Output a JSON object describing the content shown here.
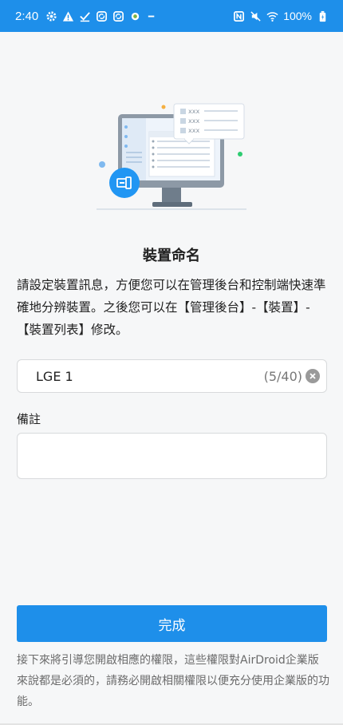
{
  "status_bar": {
    "time": "2:40",
    "battery": "100%",
    "icons_left": [
      "settings-icon",
      "warning-icon",
      "check-icon",
      "sync-icon",
      "sync-icon",
      "app-icon",
      "minus-icon"
    ],
    "icons_right": [
      "nfc-icon",
      "mute-icon",
      "wifi-icon",
      "battery-icon"
    ],
    "bg_color": "#1e8fea"
  },
  "illustration": {
    "placeholder_rows": [
      "xxx",
      "xxx",
      "xxx"
    ]
  },
  "page": {
    "title": "裝置命名",
    "description": "請設定裝置訊息，方便您可以在管理後台和控制端快速準確地分辨裝置。之後您可以在【管理後台】-【裝置】-【裝置列表】修改。"
  },
  "name_field": {
    "value": "LGE 1",
    "counter": "(5/40)"
  },
  "remark": {
    "label": "備註",
    "value": ""
  },
  "done_button": {
    "label": "完成"
  },
  "footnote": "接下來將引導您開啟相應的權限，這些權限對AirDroid企業版來說都是必須的，請務必開啟相關權限以便充分使用企業版的功能。",
  "colors": {
    "accent": "#1e8fea",
    "background": "#f6f7f8"
  }
}
